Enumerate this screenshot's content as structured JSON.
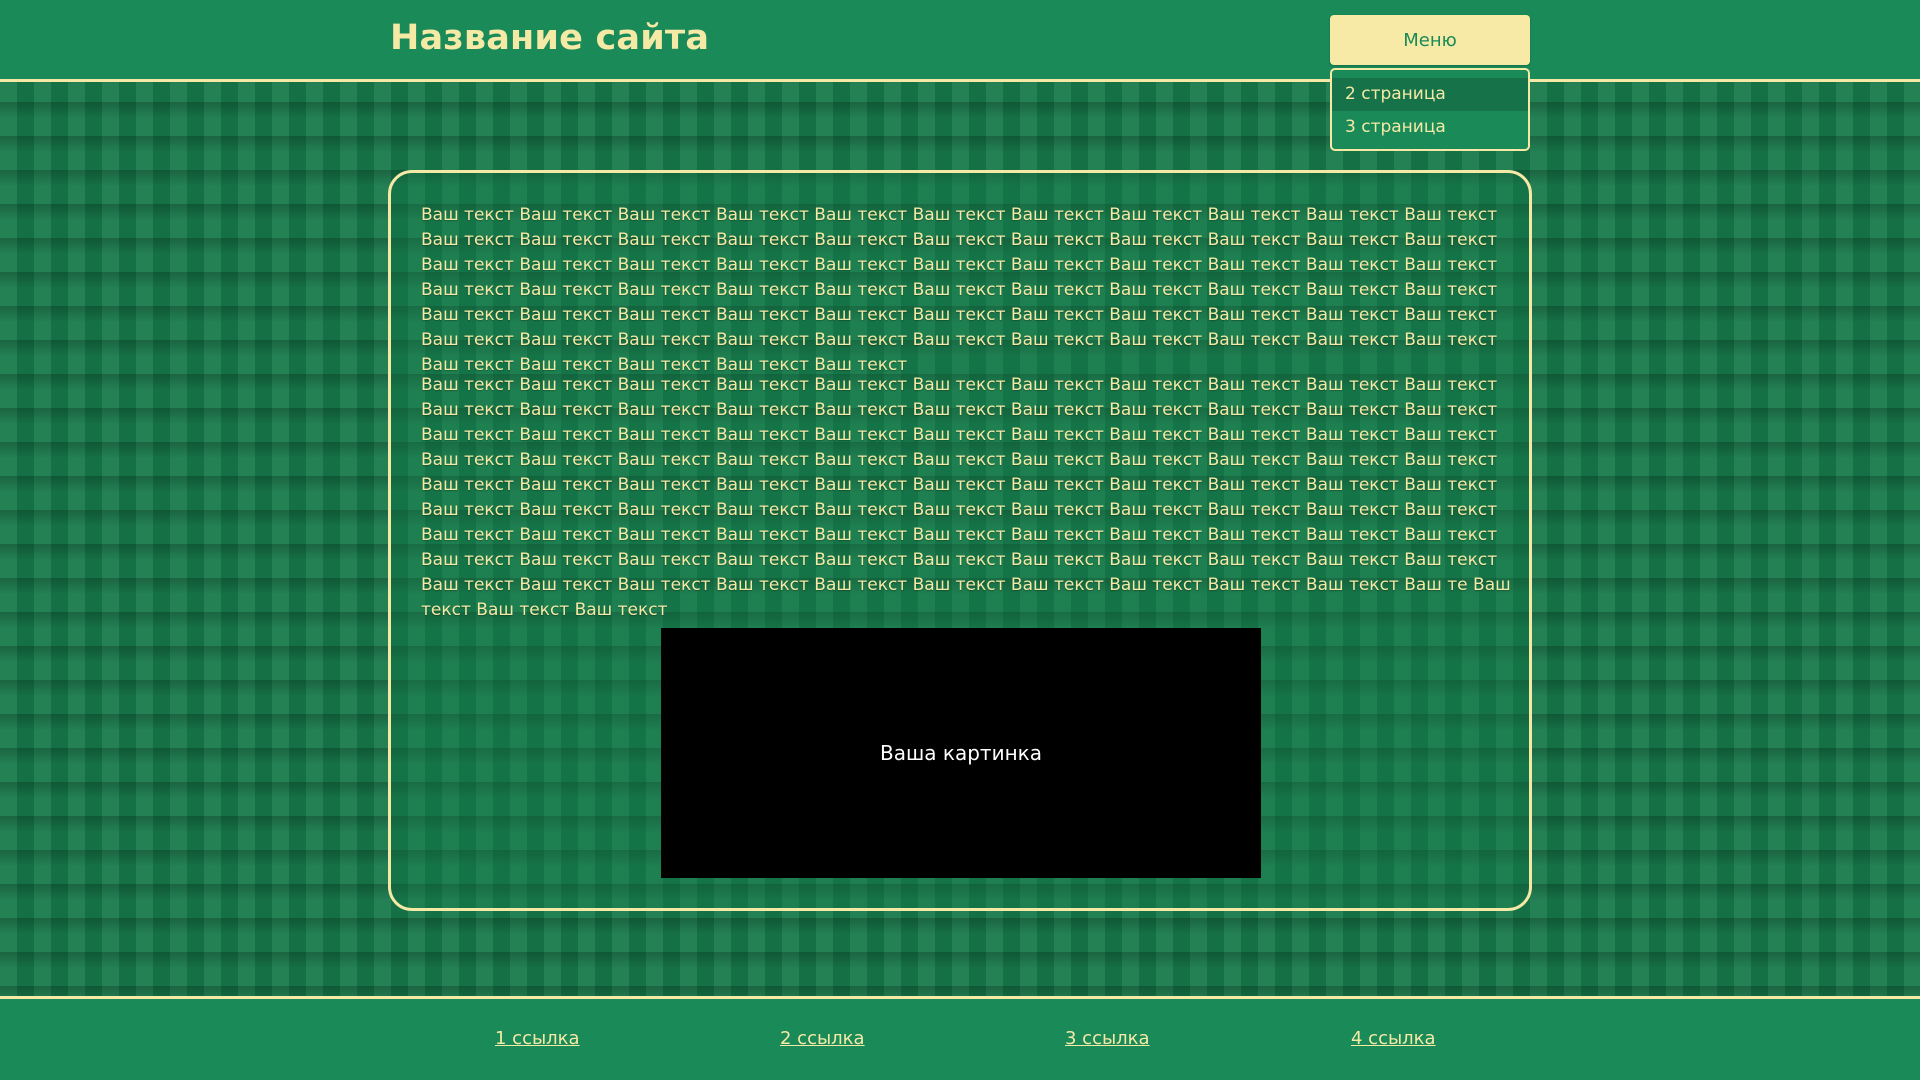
{
  "header": {
    "title": "Название сайта",
    "menu_label": "Меню",
    "dropdown": [
      {
        "label": "2 страница"
      },
      {
        "label": "3 страница"
      }
    ]
  },
  "content": {
    "paragraph1": "Ваш текст Ваш текст Ваш текст Ваш текст Ваш текст Ваш текст Ваш текст Ваш текст Ваш текст Ваш текст Ваш текст Ваш текст Ваш текст Ваш текст Ваш текст Ваш текст Ваш текст Ваш текст Ваш текст Ваш текст Ваш текст Ваш текст Ваш текст Ваш текст Ваш текст Ваш текст Ваш текст Ваш текст Ваш текст Ваш текст Ваш текст Ваш текст Ваш текст Ваш текст Ваш текст Ваш текст Ваш текст Ваш текст Ваш текст Ваш текст Ваш текст Ваш текст Ваш текст Ваш текст Ваш текст Ваш текст Ваш текст Ваш текст Ваш текст Ваш текст Ваш текст Ваш текст Ваш текст Ваш текст Ваш текст Ваш текст Ваш текст Ваш текст Ваш текст Ваш текст Ваш текст Ваш текст Ваш текст Ваш текст Ваш текст Ваш текст Ваш текст Ваш текст Ваш текст Ваш текст Ваш текст",
    "paragraph2": "Ваш текст Ваш текст Ваш текст Ваш текст Ваш текст Ваш текст Ваш текст Ваш текст Ваш текст Ваш текст Ваш текст Ваш текст Ваш текст Ваш текст Ваш текст Ваш текст Ваш текст Ваш текст Ваш текст Ваш текст Ваш текст Ваш текст Ваш текст Ваш текст Ваш текст Ваш текст Ваш текст Ваш текст Ваш текст Ваш текст Ваш текст Ваш текст Ваш текст Ваш текст Ваш текст Ваш текст Ваш текст Ваш текст Ваш текст Ваш текст Ваш текст Ваш текст Ваш текст Ваш текст Ваш текст Ваш текст Ваш текст Ваш текст Ваш текст Ваш текст Ваш текст Ваш текст Ваш текст Ваш текст Ваш текст Ваш текст Ваш текст Ваш текст Ваш текст Ваш текст Ваш текст Ваш текст Ваш текст Ваш текст Ваш текст Ваш текст Ваш текст Ваш текст  Ваш текст Ваш текст Ваш текст Ваш текст Ваш текст Ваш текст Ваш текст Ваш текст Ваш текст Ваш текст Ваш текст Ваш текст Ваш текст Ваш текст Ваш текст Ваш текст Ваш текст Ваш текст Ваш текст Ваш текст Ваш текст Ваш текст Ваш текст Ваш текст Ваш текст Ваш текст Ваш текст Ваш текст Ваш текст Ваш текст Ваш те Ваш текст Ваш текст Ваш текст",
    "image_label": "Ваша картинка"
  },
  "footer": {
    "links": [
      {
        "label": "1 ссылка"
      },
      {
        "label": "2 ссылка"
      },
      {
        "label": "3 ссылка"
      },
      {
        "label": "4 ссылка"
      }
    ]
  },
  "colors": {
    "background": "#177a4b",
    "header": "#1a8a58",
    "accent": "#f5e9a6",
    "image": "#000000"
  }
}
